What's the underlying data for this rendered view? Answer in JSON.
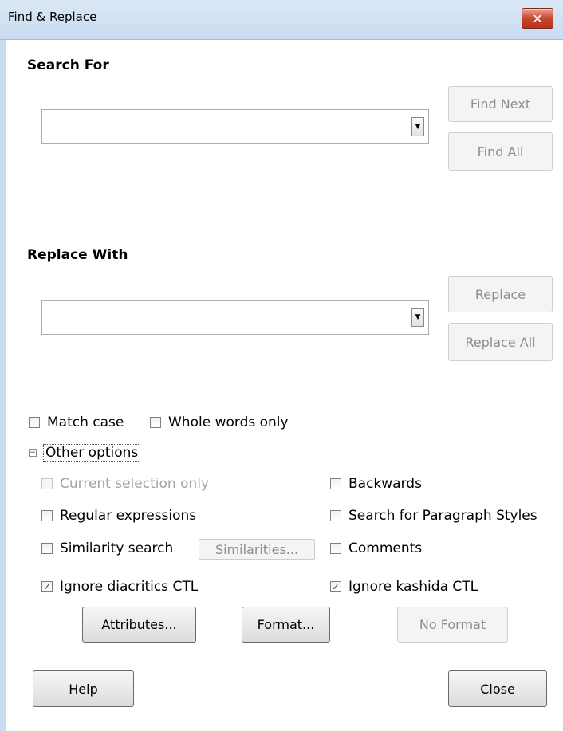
{
  "window": {
    "title": "Find & Replace",
    "close_glyph": "✕"
  },
  "search": {
    "label": "Search For",
    "value": "",
    "find_next": "Find Next",
    "find_all": "Find All"
  },
  "replace": {
    "label": "Replace With",
    "value": "",
    "replace": "Replace",
    "replace_all": "Replace All"
  },
  "options": {
    "match_case": {
      "label": "Match case",
      "checked": false
    },
    "whole_words": {
      "label": "Whole words only",
      "checked": false
    },
    "other_options": "Other options",
    "current_selection": {
      "label": "Current selection only",
      "checked": false,
      "enabled": false
    },
    "backwards": {
      "label": "Backwards",
      "checked": false
    },
    "regex": {
      "label": "Regular expressions",
      "checked": false
    },
    "para_styles": {
      "label": "Search for Paragraph Styles",
      "checked": false
    },
    "similarity": {
      "label": "Similarity search",
      "checked": false
    },
    "similarities_button": "Similarities...",
    "comments": {
      "label": "Comments",
      "checked": false
    },
    "diacritics": {
      "label": "Ignore diacritics CTL",
      "checked": true
    },
    "kashida": {
      "label": "Ignore kashida CTL",
      "checked": true
    }
  },
  "buttons": {
    "attributes": "Attributes...",
    "format": "Format...",
    "no_format": "No Format",
    "help": "Help",
    "close": "Close"
  },
  "colors": {
    "titlebar": "#c9dcf1",
    "close_button": "#c8472d",
    "check_mark": "#1f4a8a"
  }
}
